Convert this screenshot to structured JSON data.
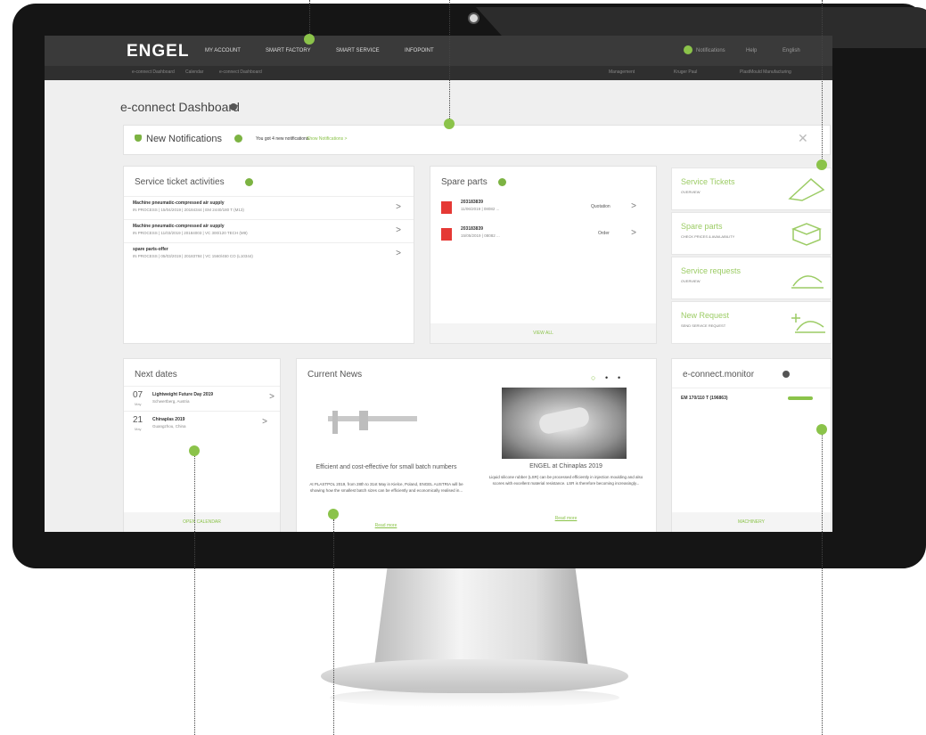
{
  "header": {
    "logo": "ENGEL",
    "nav": [
      "MY ACCOUNT",
      "SMART FACTORY",
      "SMART SERVICE",
      "INFOPOINT"
    ],
    "right": [
      "Notifications",
      "Help",
      "English"
    ]
  },
  "breadcrumb": {
    "items": [
      "e-connect Dashboard",
      "Calendar",
      "e-connect Dashboard"
    ],
    "right": [
      "Management",
      "Kruger Paul",
      "PlastMould Manufacturing"
    ]
  },
  "page_title": "e-connect Dashboard",
  "notifications": {
    "title": "New Notifications",
    "count": "4",
    "text": "You got 4 new notifications.",
    "link": "Show Notifications >"
  },
  "service_tickets": {
    "title": "Service ticket activities",
    "count": "3",
    "rows": [
      {
        "title": "Machine pneumatic-compressed air supply",
        "sub": "IN PROCESS | 15/04/2019 | 20184344 | EM 2440/180 T (M13)"
      },
      {
        "title": "Machine pneumatic-compressed air supply",
        "sub": "IN PROCESS | 11/03/2019 | 20184003 | VC 300/120 TECH (M9)"
      },
      {
        "title": "spare parts-offer",
        "sub": "IN PROCESS | 05/03/2019 | 20183784 | VC 1560/450 CO (L10344)"
      }
    ]
  },
  "spare_parts": {
    "title": "Spare parts",
    "count": "2",
    "rows": [
      {
        "title": "203183839",
        "sub": "11/06/2019 | 08082 ...",
        "status": "Quotation"
      },
      {
        "title": "203183839",
        "sub": "15/05/2019 | 08082 ...",
        "status": "Order"
      }
    ],
    "footer": "VIEW ALL"
  },
  "tiles": [
    {
      "title": "Service Tickets",
      "sub": "OVERVIEW"
    },
    {
      "title": "Spare parts",
      "sub": "CHECK PRICES & AVAILABILITY"
    },
    {
      "title": "Service requests",
      "sub": "OVERVIEW"
    },
    {
      "title": "New Request",
      "sub": "SEND SERVICE REQUEST"
    }
  ],
  "next_dates": {
    "title": "Next dates",
    "items": [
      {
        "day": "07",
        "mon": "May",
        "title": "Lightweight Future Day 2019",
        "loc": "Schwertberg, Austria"
      },
      {
        "day": "21",
        "mon": "May",
        "title": "Chinaplas 2019",
        "loc": "Guangzhou, China"
      }
    ],
    "footer": "OPEN CALENDAR"
  },
  "news": {
    "title": "Current News",
    "left_title": "Efficient and cost-effective for small batch numbers",
    "left_text": "At PLASTPOL 2019, from 28th to 31st May in Kielce, Poland, ENGEL AUSTRIA will be showing how the smallest batch sizes can be efficiently and economically realised in...",
    "right_title": "ENGEL at Chinaplas 2019",
    "right_text": "Liquid silicone rubber (LSR) can be processed efficiently in injection moulding and also scores with excellent material resistance. LSR is therefore becoming increasingly...",
    "read_more": "Read more"
  },
  "monitor": {
    "title": "e-connect.monitor",
    "machine": "EM 170/110 T (196863)",
    "footer": "MACHINERY"
  },
  "colors": {
    "accent": "#8bc34a",
    "header": "#3a3a3a",
    "bezel": "#151515"
  }
}
